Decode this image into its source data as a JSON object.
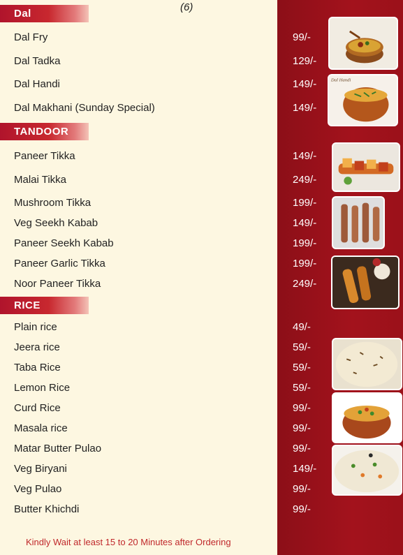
{
  "page_number": "(6)",
  "sections": {
    "dal": {
      "title": "Dal",
      "items": [
        {
          "name": "Dal Fry",
          "price": "99/-"
        },
        {
          "name": "Dal Tadka",
          "price": "129/-"
        },
        {
          "name": "Dal Handi",
          "price": "149/-"
        },
        {
          "name": "Dal Makhani (Sunday Special)",
          "price": "149/-"
        }
      ],
      "photo_caption": "Dal Handi"
    },
    "tandoor": {
      "title": "TANDOOR",
      "items": [
        {
          "name": "Paneer Tikka",
          "price": "149/-"
        },
        {
          "name": "Malai Tikka",
          "price": "249/-"
        },
        {
          "name": "Mushroom Tikka",
          "price": "199/-"
        },
        {
          "name": "Veg Seekh Kabab",
          "price": "149/-"
        },
        {
          "name": "Paneer Seekh Kabab",
          "price": "199/-"
        },
        {
          "name": "Paneer Garlic Tikka",
          "price": "199/-"
        },
        {
          "name": "Noor Paneer Tikka",
          "price": "249/-"
        }
      ]
    },
    "rice": {
      "title": "RICE",
      "items": [
        {
          "name": "Plain rice",
          "price": "49/-"
        },
        {
          "name": "Jeera rice",
          "price": "59/-"
        },
        {
          "name": "Taba Rice",
          "price": "59/-"
        },
        {
          "name": "Lemon Rice",
          "price": "59/-"
        },
        {
          "name": "Curd Rice",
          "price": "99/-"
        },
        {
          "name": "Masala rice",
          "price": "99/-"
        },
        {
          "name": "Matar Butter Pulao",
          "price": "99/-"
        },
        {
          "name": "Veg Biryani",
          "price": "149/-"
        },
        {
          "name": "Veg Pulao",
          "price": "99/-"
        },
        {
          "name": "Butter Khichdi",
          "price": "99/-"
        }
      ]
    }
  },
  "footer_note": "Kindly Wait at least 15 to 20 Minutes after Ordering",
  "colors": {
    "background": "#fdf7e1",
    "band": "#9b111a",
    "header": "#c8282f",
    "footer_text": "#c0282b"
  }
}
